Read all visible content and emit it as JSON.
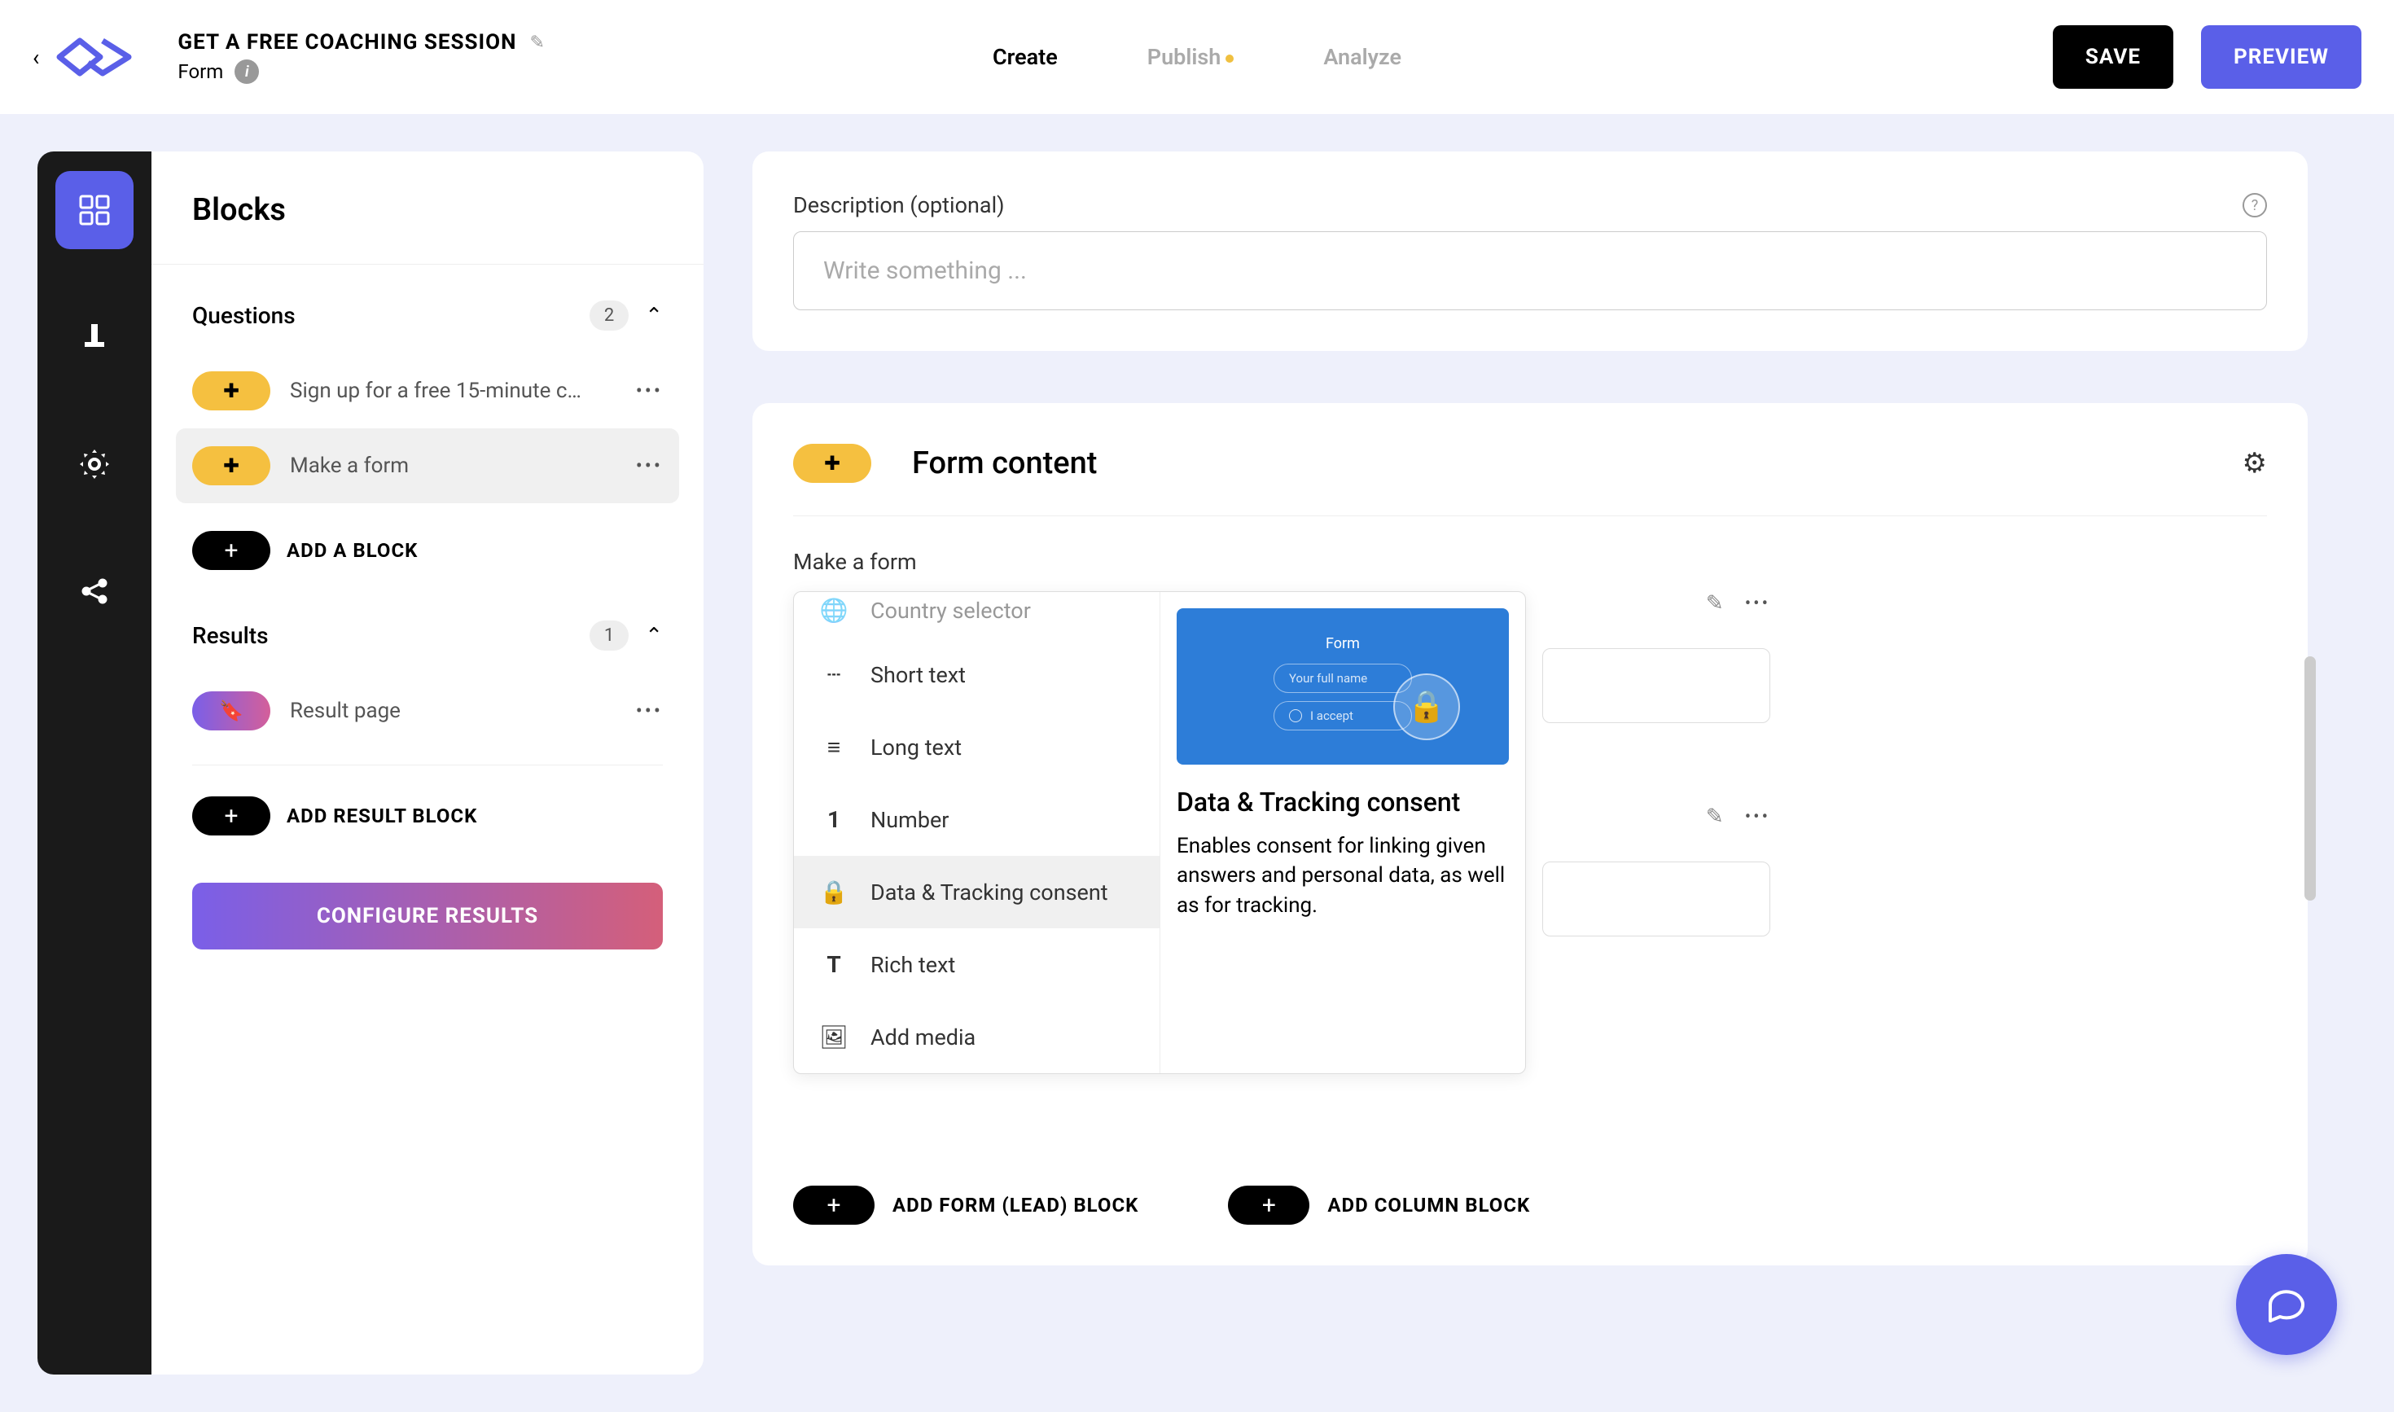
{
  "header": {
    "title": "GET A FREE COACHING SESSION",
    "subtitle": "Form",
    "tabs": {
      "create": "Create",
      "publish": "Publish",
      "analyze": "Analyze"
    },
    "save": "SAVE",
    "preview": "PREVIEW"
  },
  "sidebar": {
    "title": "Blocks",
    "questions": {
      "label": "Questions",
      "count": "2",
      "items": [
        {
          "label": "Sign up for a free 15-minute c…"
        },
        {
          "label": "Make a form"
        }
      ],
      "add": "ADD A BLOCK"
    },
    "results": {
      "label": "Results",
      "count": "1",
      "items": [
        {
          "label": "Result page"
        }
      ],
      "add": "ADD RESULT BLOCK"
    },
    "configure": "CONFIGURE RESULTS"
  },
  "description_card": {
    "label": "Description (optional)",
    "placeholder": "Write something ..."
  },
  "form_card": {
    "title": "Form content",
    "subtitle": "Make a form",
    "add_form_lead": "ADD FORM (LEAD) BLOCK",
    "add_column": "ADD COLUMN BLOCK"
  },
  "dropdown": {
    "items": [
      {
        "icon": "globe",
        "label": "Country selector"
      },
      {
        "icon": "dash",
        "label": "Short text"
      },
      {
        "icon": "lines",
        "label": "Long text"
      },
      {
        "icon": "one",
        "label": "Number"
      },
      {
        "icon": "lock",
        "label": "Data & Tracking consent"
      },
      {
        "icon": "tee",
        "label": "Rich text"
      },
      {
        "icon": "image",
        "label": "Add media"
      }
    ],
    "preview": {
      "form_label": "Form",
      "field_placeholder": "Your full name",
      "accept_label": "I accept",
      "title": "Data & Tracking consent",
      "desc": "Enables consent for linking given answers and personal data, as well as for tracking."
    }
  }
}
